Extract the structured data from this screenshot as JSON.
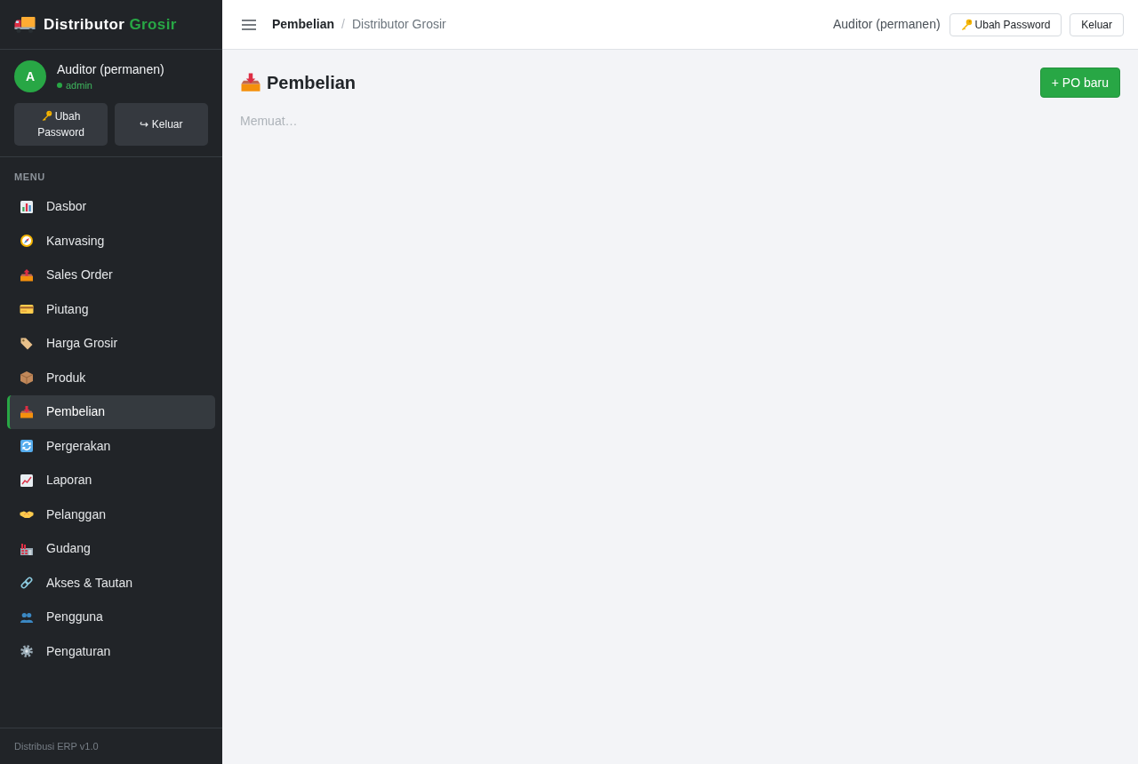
{
  "sidebar": {
    "brand": {
      "name": "Distributor",
      "accent": "Grosir"
    },
    "user": {
      "initial": "A",
      "name": "Auditor (permanen)",
      "role": "admin"
    },
    "buttons": [
      {
        "kind": "password",
        "label": "Ubah Password"
      },
      {
        "kind": "logout",
        "label": "↪ Keluar"
      }
    ],
    "menu_heading": "MENU",
    "items": [
      {
        "label": "Dasbor",
        "selected": false
      },
      {
        "label": "Kanvasing",
        "selected": false
      },
      {
        "label": "Sales Order",
        "selected": false
      },
      {
        "label": "Piutang",
        "selected": false
      },
      {
        "label": "Harga Grosir",
        "selected": false
      },
      {
        "label": "Produk",
        "selected": false
      },
      {
        "label": "Pembelian",
        "selected": true
      },
      {
        "label": "Pergerakan",
        "selected": false
      },
      {
        "label": "Laporan",
        "selected": false
      },
      {
        "label": "Pelanggan",
        "selected": false
      },
      {
        "label": "Gudang",
        "selected": false
      },
      {
        "label": "Akses & Tautan",
        "selected": false
      },
      {
        "label": "Pengguna",
        "selected": false
      },
      {
        "label": "Pengaturan",
        "selected": false
      }
    ],
    "footer": "Distribusi ERP v1.0"
  },
  "topbar": {
    "breadcrumb": {
      "current": "Pembelian",
      "separator": "/",
      "parent": "Distributor Grosir"
    },
    "user_name": "Auditor (permanen)",
    "buttons": [
      {
        "kind": "password",
        "label": "Ubah Password"
      },
      {
        "kind": "logout",
        "label": "Keluar"
      }
    ]
  },
  "page": {
    "title": "Pembelian",
    "action": "+ PO baru",
    "status": "Memuat…"
  }
}
